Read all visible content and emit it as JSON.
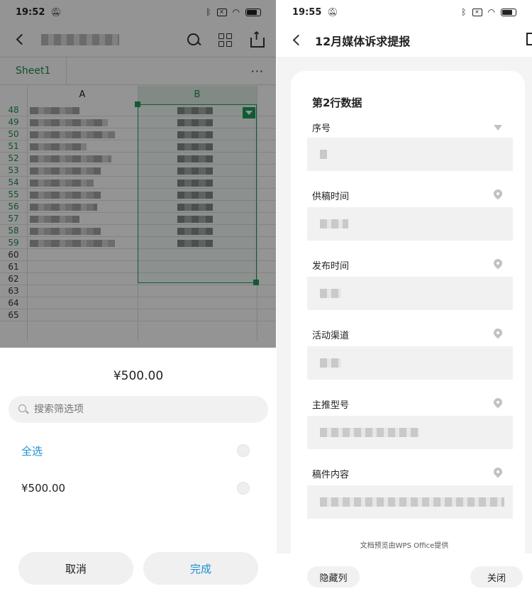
{
  "left": {
    "status": {
      "time": "19:52"
    },
    "sheet_tab": "Sheet1",
    "more": "···",
    "columns": [
      "A",
      "B"
    ],
    "rows": [
      "48",
      "49",
      "50",
      "51",
      "52",
      "53",
      "54",
      "55",
      "56",
      "57",
      "58",
      "59",
      "60",
      "61",
      "62",
      "63",
      "64",
      "65"
    ],
    "filter_sheet": {
      "title": "¥500.00",
      "search_placeholder": "搜索筛选项",
      "options": [
        {
          "label": "全选"
        },
        {
          "label": "¥500.00"
        }
      ],
      "cancel_label": "取消",
      "done_label": "完成"
    },
    "colors": {
      "accent_green": "#1e9e5a",
      "accent_blue": "#1d8fd1"
    }
  },
  "right": {
    "status": {
      "time": "19:55"
    },
    "title": "12月媒体诉求提报",
    "card_title": "第2行数据",
    "fields": [
      {
        "label": "序号"
      },
      {
        "label": "供稿时间"
      },
      {
        "label": "发布时间"
      },
      {
        "label": "活动渠道"
      },
      {
        "label": "主推型号"
      },
      {
        "label": "稿件内容"
      }
    ],
    "note": "文档预览由WPS Office提供",
    "hide_col_label": "隐藏列",
    "close_label": "关闭"
  }
}
